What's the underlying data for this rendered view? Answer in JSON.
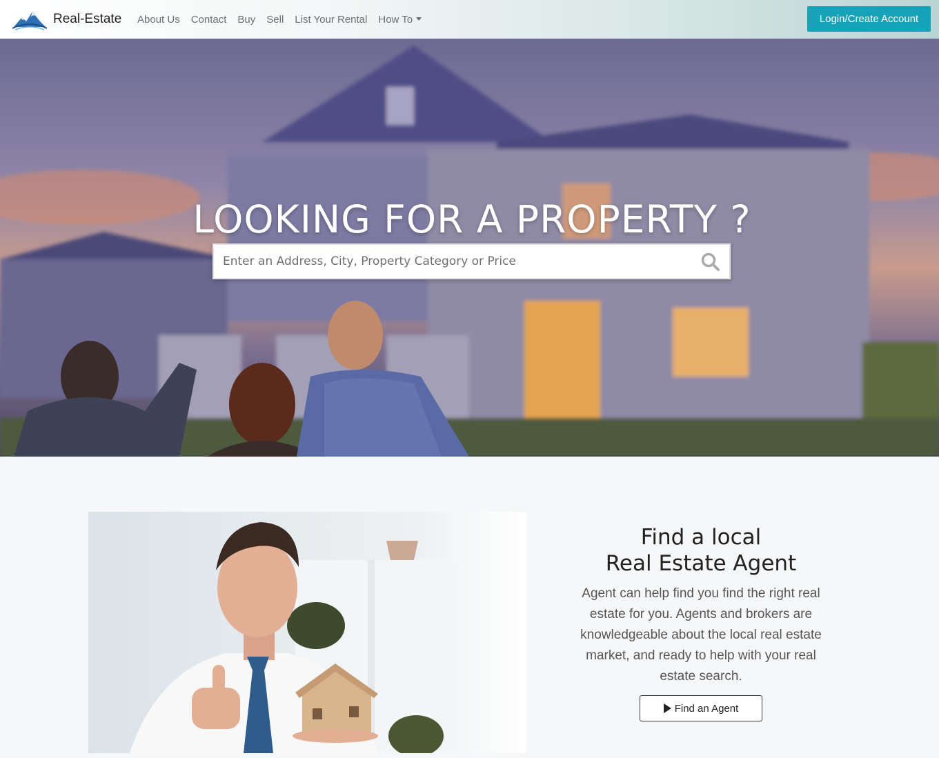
{
  "brand": {
    "name": "Real-Estate",
    "logo_icon": "mountain-logo-icon"
  },
  "nav": {
    "items": [
      {
        "label": "About Us"
      },
      {
        "label": "Contact"
      },
      {
        "label": "Buy"
      },
      {
        "label": "Sell"
      },
      {
        "label": "List Your Rental"
      },
      {
        "label": "How To"
      }
    ],
    "login_label": "Login/Create Account"
  },
  "hero": {
    "title": "LOOKING FOR A PROPERTY ?",
    "search_placeholder": "Enter an Address, City, Property Category or Price",
    "search_value": "",
    "search_icon": "search-icon"
  },
  "agent": {
    "title_line1": "Find a local",
    "title_line2": "Real Estate Agent",
    "description": "Agent can help find you find the right real estate for you. Agents and brokers are knowledgeable about the local real estate market, and ready to help with your real estate search.",
    "button_label": "Find an Agent",
    "button_icon": "play-icon"
  },
  "colors": {
    "accent": "#16a2b8",
    "background": "#f6f7f9"
  }
}
